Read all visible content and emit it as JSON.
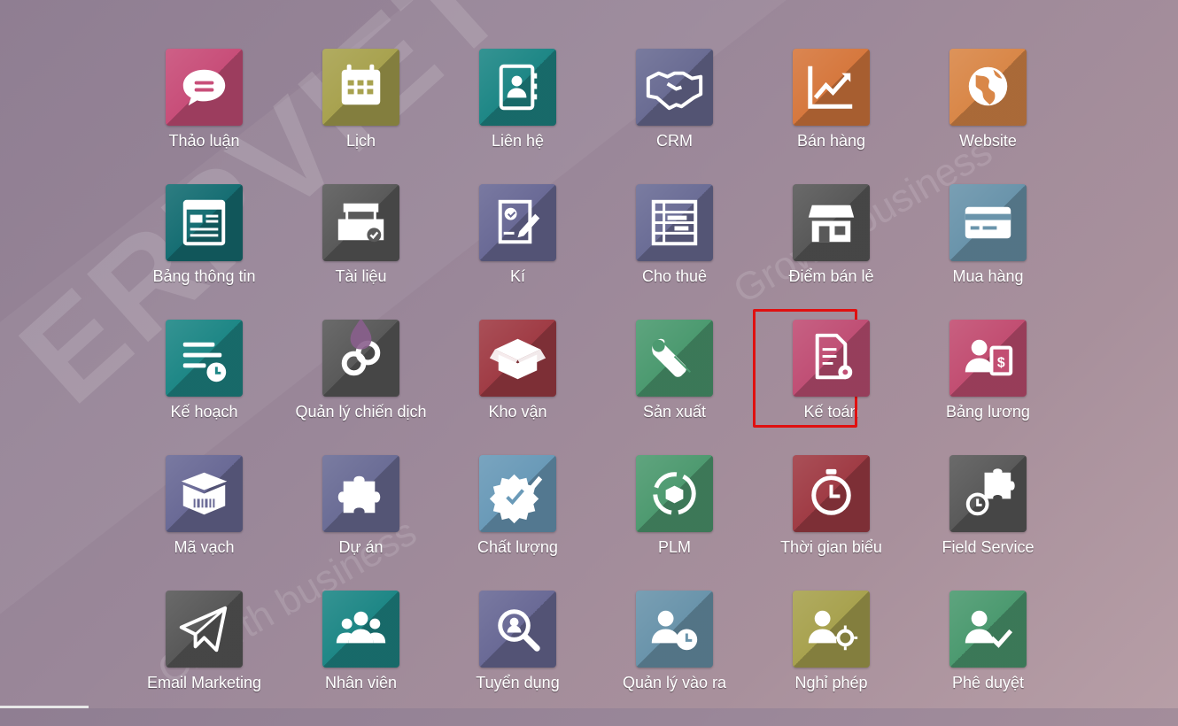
{
  "apps": [
    {
      "label": "Thảo luận",
      "icon": "chat-bubble-icon",
      "color": "#c84e79"
    },
    {
      "label": "Lịch",
      "icon": "calendar-icon",
      "color": "#a8a24f"
    },
    {
      "label": "Liên hệ",
      "icon": "address-book-icon",
      "color": "#1e8786"
    },
    {
      "label": "CRM",
      "icon": "handshake-icon",
      "color": "#6a6c93"
    },
    {
      "label": "Bán hàng",
      "icon": "trending-chart-icon",
      "color": "#d6783e"
    },
    {
      "label": "Website",
      "icon": "globe-icon",
      "color": "#d98748"
    },
    {
      "label": "Bảng thông tin",
      "icon": "dashboard-icon",
      "color": "#166e73"
    },
    {
      "label": "Tài liệu",
      "icon": "document-inbox-icon",
      "color": "#5a5a5a"
    },
    {
      "label": "Kí",
      "icon": "signature-icon",
      "color": "#6a6a96"
    },
    {
      "label": "Cho thuê",
      "icon": "rental-table-icon",
      "color": "#6b6d96"
    },
    {
      "label": "Điểm bán lẻ",
      "icon": "shop-icon",
      "color": "#595959"
    },
    {
      "label": "Mua hàng",
      "icon": "credit-card-icon",
      "color": "#6a94ab"
    },
    {
      "label": "Kế hoạch",
      "icon": "planning-icon",
      "color": "#1e8786"
    },
    {
      "label": "Quản lý chiến dịch",
      "icon": "chain-link-icon",
      "color": "#5a5a5a"
    },
    {
      "label": "Kho vận",
      "icon": "open-box-icon",
      "color": "#a03c45"
    },
    {
      "label": "Sản xuất",
      "icon": "wrench-icon",
      "color": "#4c9a70"
    },
    {
      "label": "Kế toán",
      "icon": "invoice-gear-icon",
      "color": "#c04f75"
    },
    {
      "label": "Bảng lương",
      "icon": "payroll-icon",
      "color": "#c24e72"
    },
    {
      "label": "Mã vạch",
      "icon": "barcode-box-icon",
      "color": "#6a6a96"
    },
    {
      "label": "Dự án",
      "icon": "puzzle-icon",
      "color": "#6b6d96"
    },
    {
      "label": "Chất lượng",
      "icon": "quality-badge-icon",
      "color": "#6a9ab8"
    },
    {
      "label": "PLM",
      "icon": "cycle-box-icon",
      "color": "#4e9a70"
    },
    {
      "label": "Thời gian biểu",
      "icon": "stopwatch-icon",
      "color": "#a03c45"
    },
    {
      "label": "Field Service",
      "icon": "puzzle-timer-icon",
      "color": "#5a5a5a"
    },
    {
      "label": "Email Marketing",
      "icon": "paper-plane-icon",
      "color": "#595959"
    },
    {
      "label": "Nhân viên",
      "icon": "team-icon",
      "color": "#1e8786"
    },
    {
      "label": "Tuyển dụng",
      "icon": "magnifier-user-icon",
      "color": "#6a6a96"
    },
    {
      "label": "Quản lý vào ra",
      "icon": "user-clock-icon",
      "color": "#6a94ab"
    },
    {
      "label": "Nghỉ phép",
      "icon": "user-sun-icon",
      "color": "#a8a24f"
    },
    {
      "label": "Phê duyệt",
      "icon": "user-check-icon",
      "color": "#4c9a70"
    }
  ],
  "selected_app": "Kế toán",
  "watermark": {
    "brand": "ERPVIET",
    "tagline": "Growth business"
  }
}
